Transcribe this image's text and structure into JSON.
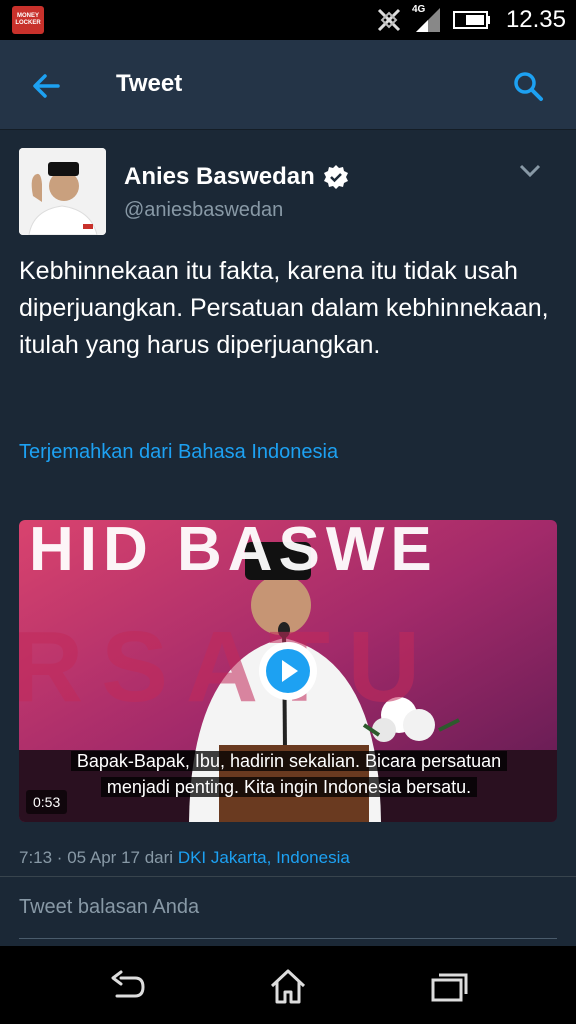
{
  "status_bar": {
    "app_badge": "MONEY LOCKER",
    "network": "4G",
    "time": "12.35"
  },
  "app_bar": {
    "title": "Tweet"
  },
  "tweet": {
    "author_name": "Anies Baswedan",
    "handle": "@aniesbaswedan",
    "text": "Kebhinnekaan itu fakta, karena itu tidak usah diperjuangkan. Persatuan dalam kebhinnekaan, itulah yang harus diperjuangkan.",
    "translate_label": "Terjemahkan dari Bahasa Indonesia",
    "video": {
      "backdrop_text_top": "HID BASWE",
      "backdrop_text_mid": "RSATU",
      "caption_line1": "Bapak-Bapak, Ibu, hadirin sekalian. Bicara persatuan",
      "caption_line2": "menjadi penting. Kita ingin Indonesia bersatu.",
      "duration": "0:53"
    },
    "meta_time": "7:13 · 05 Apr 17",
    "meta_from": "dari",
    "meta_location": "DKI Jakarta, Indonesia"
  },
  "reply": {
    "placeholder": "Tweet balasan Anda"
  },
  "colors": {
    "accent": "#1da1f2",
    "background": "#1b2836",
    "header": "#243447"
  }
}
